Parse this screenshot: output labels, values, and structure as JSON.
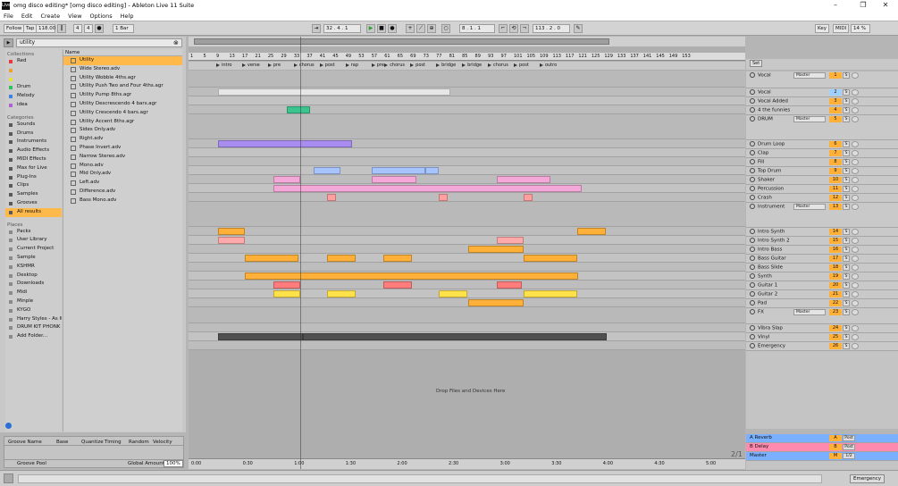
{
  "window": {
    "title": "omg disco editing*  [omg disco editing] - Ableton Live 11 Suite"
  },
  "menu": [
    "File",
    "Edit",
    "Create",
    "View",
    "Options",
    "Help"
  ],
  "transport": {
    "follow": "Follow",
    "tap": "Tap",
    "tempo": "118.00",
    "sig_num": "4",
    "sig_den": "4",
    "metro": "1 Bar",
    "position": "32 .   4 .   1",
    "loop_start": "8 .   1 .   1",
    "loop_len": "113 .   2 .   0",
    "key": "Key",
    "midi": "MIDI",
    "cpu": "14 %"
  },
  "browser": {
    "search": "utility",
    "collections_header": "Collections",
    "collections": [
      {
        "label": "Red",
        "color": "#e83a3a"
      },
      {
        "label": "",
        "color": "#f0a030"
      },
      {
        "label": "",
        "color": "#e8e040"
      },
      {
        "label": "Drum",
        "color": "#30c060"
      },
      {
        "label": "Melody",
        "color": "#4080e0"
      },
      {
        "label": "idea",
        "color": "#b060d0"
      }
    ],
    "categories_header": "Categories",
    "categories": [
      "Sounds",
      "Drums",
      "Instruments",
      "Audio Effects",
      "MIDI Effects",
      "Max for Live",
      "Plug-Ins",
      "Clips",
      "Samples",
      "Grooves",
      "All results"
    ],
    "places_header": "Places",
    "places": [
      "Packs",
      "User Library",
      "Current Project",
      "Sample",
      "KSHMR",
      "Desktop",
      "Downloads",
      "Midi",
      "Minple",
      "KYGO",
      "Harry Styles - As It Wa",
      "DRUM KIT PHONK @",
      "Add Folder..."
    ],
    "name_header": "Name",
    "results": [
      "Utility",
      "Wide Stereo.adv",
      "Utility Wobble 4ths.agr",
      "Utility Push Two and Four 4ths.agr",
      "Utility Pump 8ths.agr",
      "Utility Descrescendo 4 bars.agr",
      "Utility Crescendo 4 bars.agr",
      "Utility Accent 8ths.agr",
      "Sides Only.adv",
      "Right.adv",
      "Phase Invert.adv",
      "Narrow Stereo.adv",
      "Mono.adv",
      "Mid Only.adv",
      "Left.adv",
      "Difference.adv",
      "Bass Mono.adv"
    ],
    "groove": {
      "name": "Groove Name",
      "base": "Base",
      "quantize": "Quantize",
      "timing": "Timing",
      "random": "Random",
      "velocity": "Velocity",
      "pool": "Groove Pool",
      "global": "Global Amount",
      "amount": "100%"
    }
  },
  "ruler": [
    "1",
    "5",
    "9",
    "13",
    "17",
    "21",
    "25",
    "29",
    "33",
    "37",
    "41",
    "45",
    "49",
    "53",
    "57",
    "61",
    "65",
    "69",
    "73",
    "77",
    "81",
    "85",
    "89",
    "93",
    "97",
    "101",
    "105",
    "109",
    "113",
    "117",
    "121",
    "125",
    "129",
    "133",
    "137",
    "141",
    "145",
    "149",
    "153"
  ],
  "locators": [
    {
      "label": "intro",
      "bar": 9
    },
    {
      "label": "verse",
      "bar": 17
    },
    {
      "label": "pre",
      "bar": 25
    },
    {
      "label": "chorus",
      "bar": 33
    },
    {
      "label": "post",
      "bar": 41
    },
    {
      "label": "rap",
      "bar": 49
    },
    {
      "label": "pre",
      "bar": 57
    },
    {
      "label": "chorus",
      "bar": 61
    },
    {
      "label": "post",
      "bar": 69
    },
    {
      "label": "bridge",
      "bar": 77
    },
    {
      "label": "bridge",
      "bar": 85
    },
    {
      "label": "chorus",
      "bar": 93
    },
    {
      "label": "post",
      "bar": 101
    },
    {
      "label": "outro",
      "bar": 109
    }
  ],
  "set_label": "Set",
  "drop_text": "Drop Files and Devices Here",
  "timeline": [
    "0:00",
    "0:30",
    "1:00",
    "1:30",
    "2:00",
    "2:30",
    "3:00",
    "3:30",
    "4:00",
    "4:30",
    "5:00"
  ],
  "fraction": "2/1",
  "tracks": [
    {
      "name": "Vocal",
      "num": "1",
      "group": true,
      "route": "Master",
      "color": "#ffb038"
    },
    {
      "name": "Vocal",
      "num": "2",
      "color": "#9fd0ff"
    },
    {
      "name": "Vocal Added",
      "num": "3",
      "color": "#ffb038"
    },
    {
      "name": "4 the funnies",
      "num": "4",
      "color": "#ffb038"
    },
    {
      "name": "DRUM",
      "num": "5",
      "group": true,
      "route": "Master",
      "color": "#ffb038"
    },
    {
      "name": "Drum Loop",
      "num": "6",
      "color": "#ffb038"
    },
    {
      "name": "Clap",
      "num": "7",
      "color": "#ffb038"
    },
    {
      "name": "Fill",
      "num": "8",
      "color": "#ffb038"
    },
    {
      "name": "Top Drum",
      "num": "9",
      "color": "#ffb038"
    },
    {
      "name": "Shaker",
      "num": "10",
      "color": "#ffb038"
    },
    {
      "name": "Percussion",
      "num": "11",
      "color": "#ffb038"
    },
    {
      "name": "Crash",
      "num": "12",
      "color": "#ffb038"
    },
    {
      "name": "Instrument",
      "num": "13",
      "group": true,
      "route": "Master",
      "color": "#ffb038"
    },
    {
      "name": "Intro Synth",
      "num": "14",
      "color": "#ffb038"
    },
    {
      "name": "Intro Synth 2",
      "num": "15",
      "color": "#ffb038"
    },
    {
      "name": "Intro Bass",
      "num": "16",
      "color": "#ffb038"
    },
    {
      "name": "Bass Guitar",
      "num": "17",
      "color": "#ffb038"
    },
    {
      "name": "Bass Slide",
      "num": "18",
      "color": "#ffb038"
    },
    {
      "name": "Synth",
      "num": "19",
      "color": "#ffb038"
    },
    {
      "name": "Guitar 1",
      "num": "20",
      "color": "#ffb038"
    },
    {
      "name": "Guitar 2",
      "num": "21",
      "color": "#ffb038"
    },
    {
      "name": "Pad",
      "num": "22",
      "color": "#ffb038"
    },
    {
      "name": "FX",
      "num": "23",
      "group": true,
      "route": "Master",
      "color": "#ffb038"
    },
    {
      "name": "Vibra Slap",
      "num": "24",
      "color": "#ffb038"
    },
    {
      "name": "Vinyl",
      "num": "25",
      "color": "#ffb038"
    },
    {
      "name": "Emergency",
      "num": "26",
      "color": "#ffb038"
    }
  ],
  "returns": [
    {
      "name": "A Reverb",
      "letter": "A",
      "post": "Post"
    },
    {
      "name": "B Delay",
      "letter": "B",
      "post": "Post"
    },
    {
      "name": "Master",
      "letter": "M",
      "post": "1/2"
    }
  ],
  "bottom": {
    "emergency": "Emergency"
  }
}
